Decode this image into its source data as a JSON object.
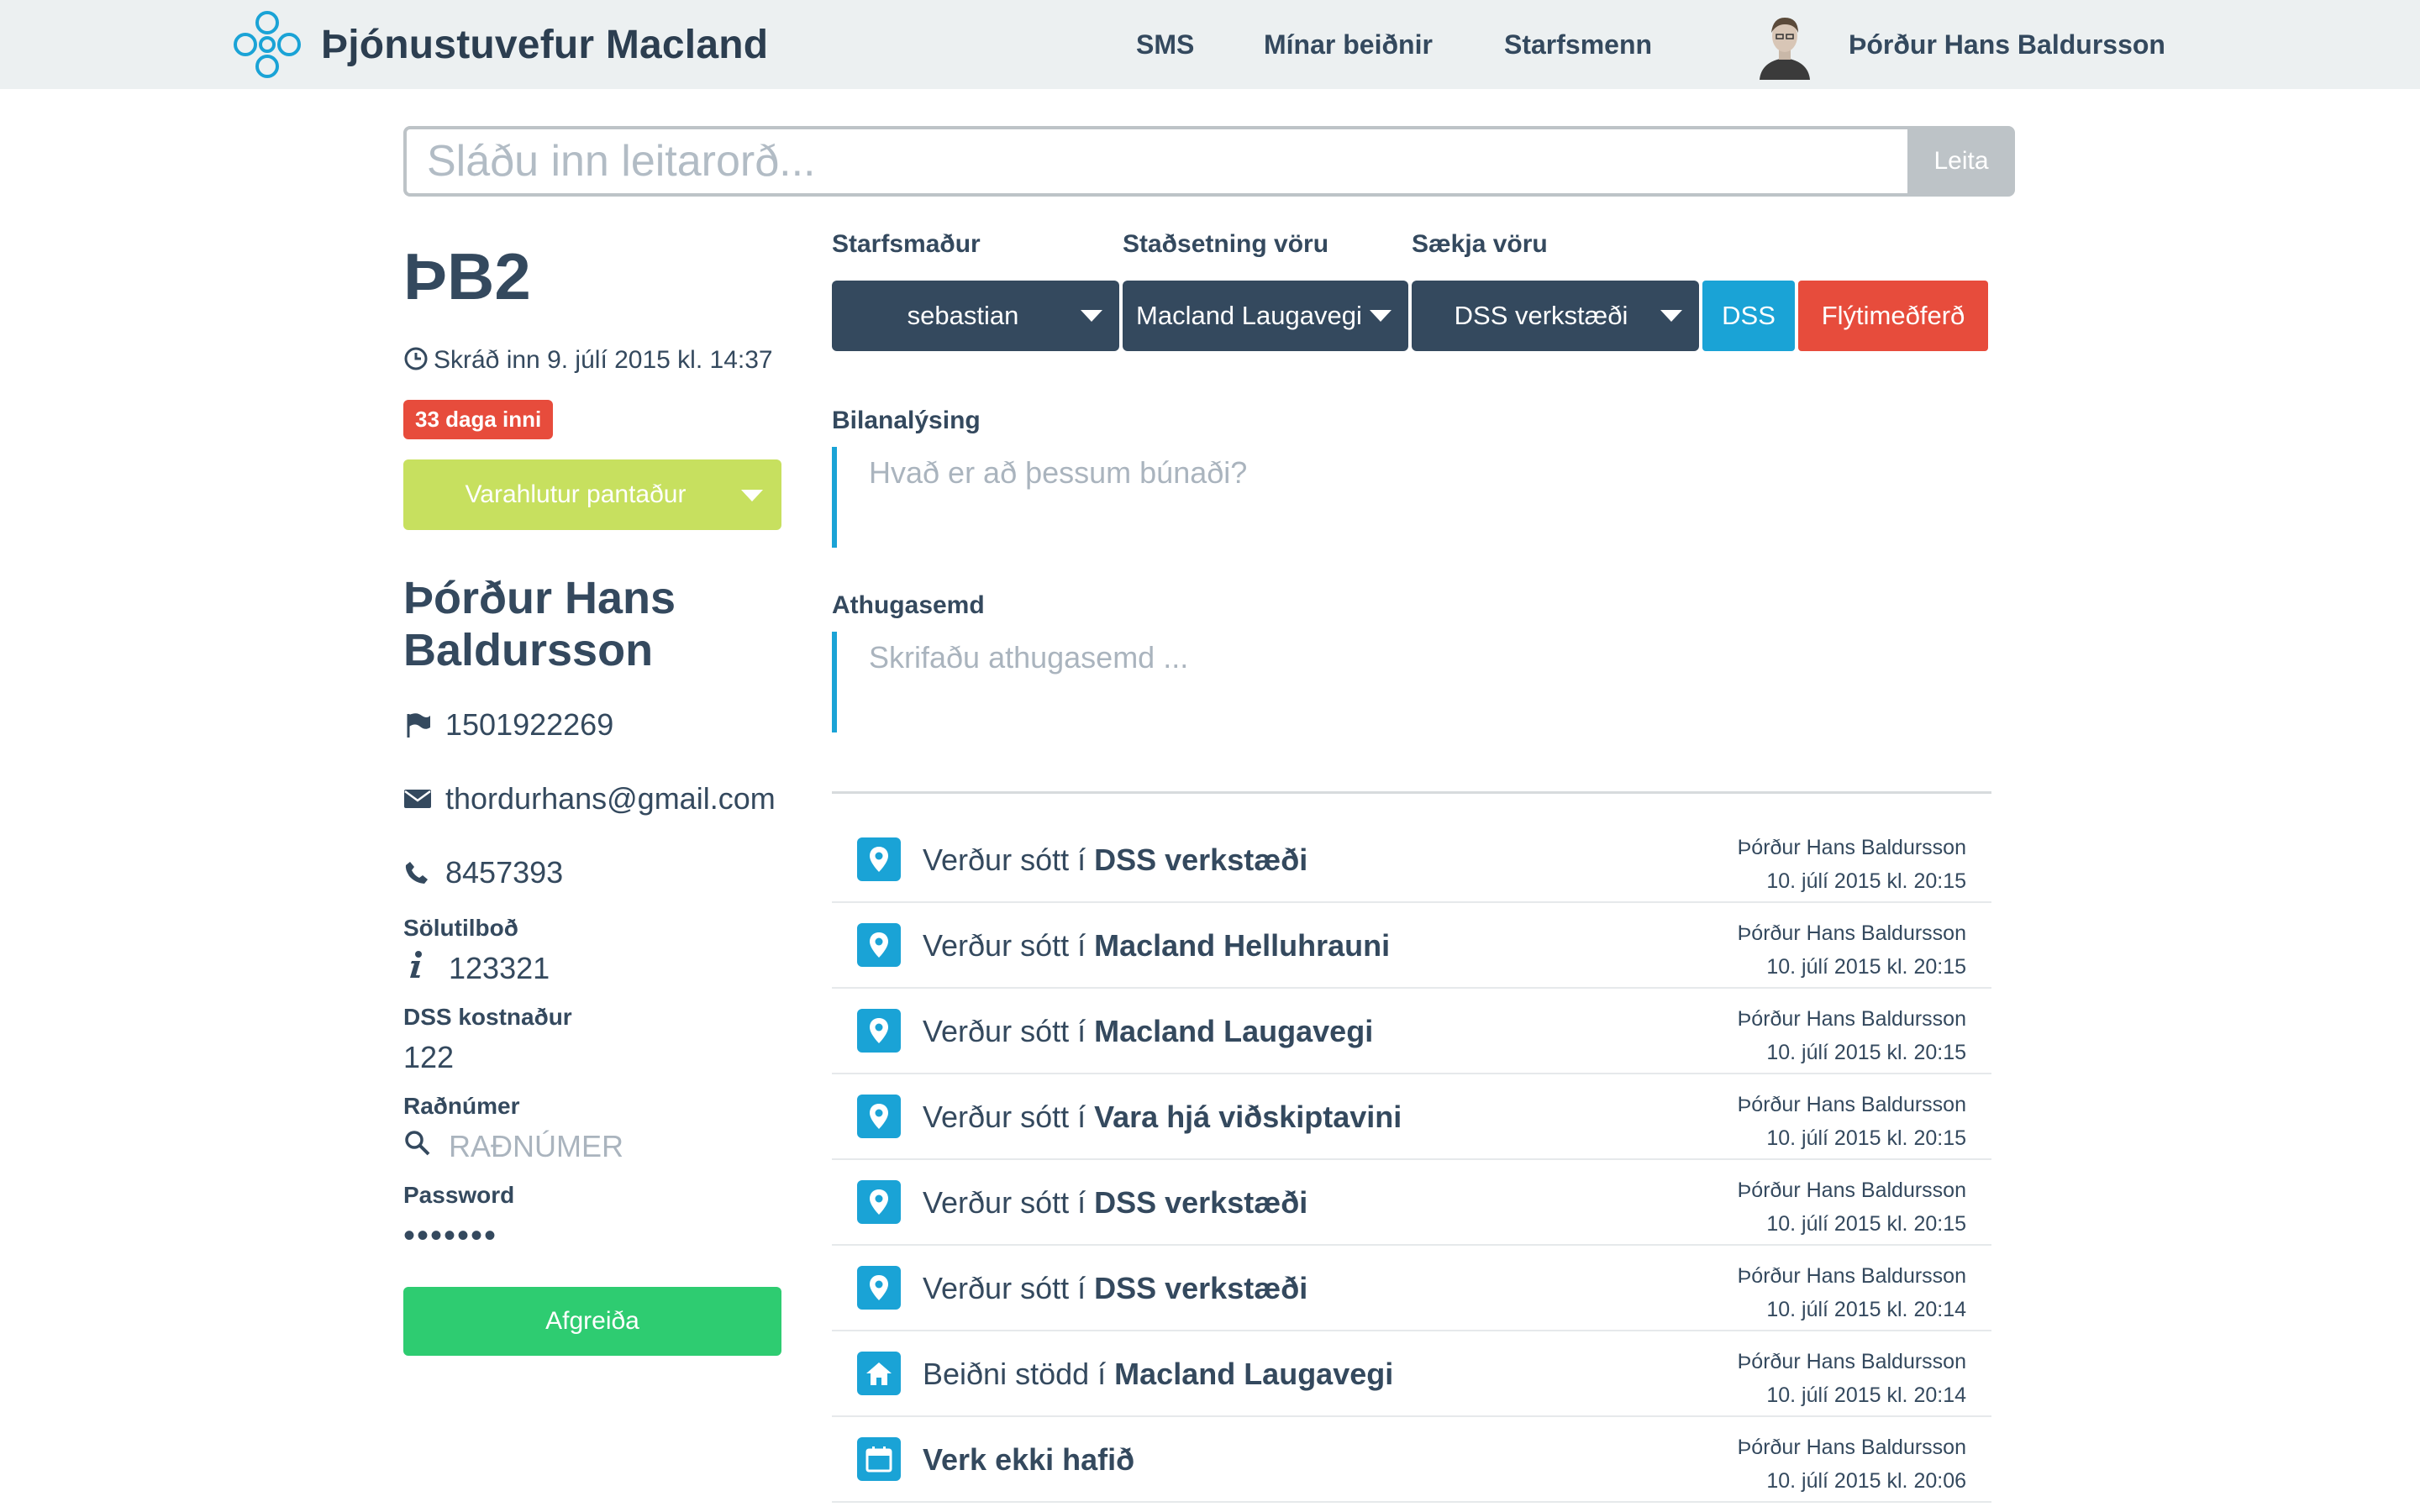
{
  "header": {
    "brand": "Þjónustuvefur Macland",
    "nav": {
      "sms": "SMS",
      "minar": "Mínar beiðnir",
      "starfsmenn": "Starfsmenn"
    },
    "user_name": "Þórður Hans Baldursson"
  },
  "search": {
    "placeholder": "Sláðu inn leitarorð...",
    "button": "Leita"
  },
  "ticket": {
    "id": "ÞB2",
    "checked_in": "Skráð inn 9. júlí 2015 kl. 14:37",
    "days_badge": "33 daga inni",
    "status": "Varahlutur pantaður"
  },
  "customer": {
    "name": "Þórður Hans Baldursson",
    "kennitala": "1501922269",
    "email": "thordurhans@gmail.com",
    "phone": "8457393"
  },
  "fields": {
    "solutilbod_label": "Sölutilboð",
    "solutilbod_value": "123321",
    "dss_label": "DSS kostnaður",
    "dss_value": "122",
    "radnumer_label": "Raðnúmer",
    "radnumer_placeholder": "RAÐNÚMER",
    "password_label": "Password",
    "password_value": "•••••••",
    "submit": "Afgreiða"
  },
  "filters": {
    "starfsmadur_label": "Starfsmaður",
    "stadsetning_label": "Staðsetning vöru",
    "saekja_label": "Sækja vöru",
    "starfsmadur_value": "sebastian",
    "stadsetning_value": "Macland Laugavegi",
    "saekja_value": "DSS verkstæði",
    "dss_button": "DSS",
    "fly_button": "Flýtimeðferð"
  },
  "bilanalysing": {
    "label": "Bilanalýsing",
    "placeholder": "Hvað er að þessum búnaði?"
  },
  "athugasemd": {
    "label": "Athugasemd",
    "placeholder": "Skrifaðu athugasemd ..."
  },
  "log": [
    {
      "icon": "location-pin-icon",
      "prefix": "Verður sótt í",
      "bold": "DSS verkstæði",
      "author": "Þórður Hans Baldursson",
      "time": "10. júlí 2015 kl. 20:15"
    },
    {
      "icon": "location-pin-icon",
      "prefix": "Verður sótt í",
      "bold": "Macland Helluhrauni",
      "author": "Þórður Hans Baldursson",
      "time": "10. júlí 2015 kl. 20:15"
    },
    {
      "icon": "location-pin-icon",
      "prefix": "Verður sótt í",
      "bold": "Macland Laugavegi",
      "author": "Þórður Hans Baldursson",
      "time": "10. júlí 2015 kl. 20:15"
    },
    {
      "icon": "location-pin-icon",
      "prefix": "Verður sótt í",
      "bold": "Vara hjá viðskiptavini",
      "author": "Þórður Hans Baldursson",
      "time": "10. júlí 2015 kl. 20:15"
    },
    {
      "icon": "location-pin-icon",
      "prefix": "Verður sótt í",
      "bold": "DSS verkstæði",
      "author": "Þórður Hans Baldursson",
      "time": "10. júlí 2015 kl. 20:15"
    },
    {
      "icon": "location-pin-icon",
      "prefix": "Verður sótt í",
      "bold": "DSS verkstæði",
      "author": "Þórður Hans Baldursson",
      "time": "10. júlí 2015 kl. 20:14"
    },
    {
      "icon": "home-icon",
      "prefix": "Beiðni stödd í",
      "bold": "Macland Laugavegi",
      "author": "Þórður Hans Baldursson",
      "time": "10. júlí 2015 kl. 20:14"
    },
    {
      "icon": "calendar-icon",
      "prefix": "",
      "bold": "Verk ekki hafið",
      "author": "Þórður Hans Baldursson",
      "time": "10. júlí 2015 kl. 20:06"
    }
  ],
  "colors": {
    "accent": "#1aa3d6",
    "dark": "#34495e",
    "danger": "#e74c3c",
    "success": "#2ecc71",
    "status_lime": "#c7e05f"
  }
}
